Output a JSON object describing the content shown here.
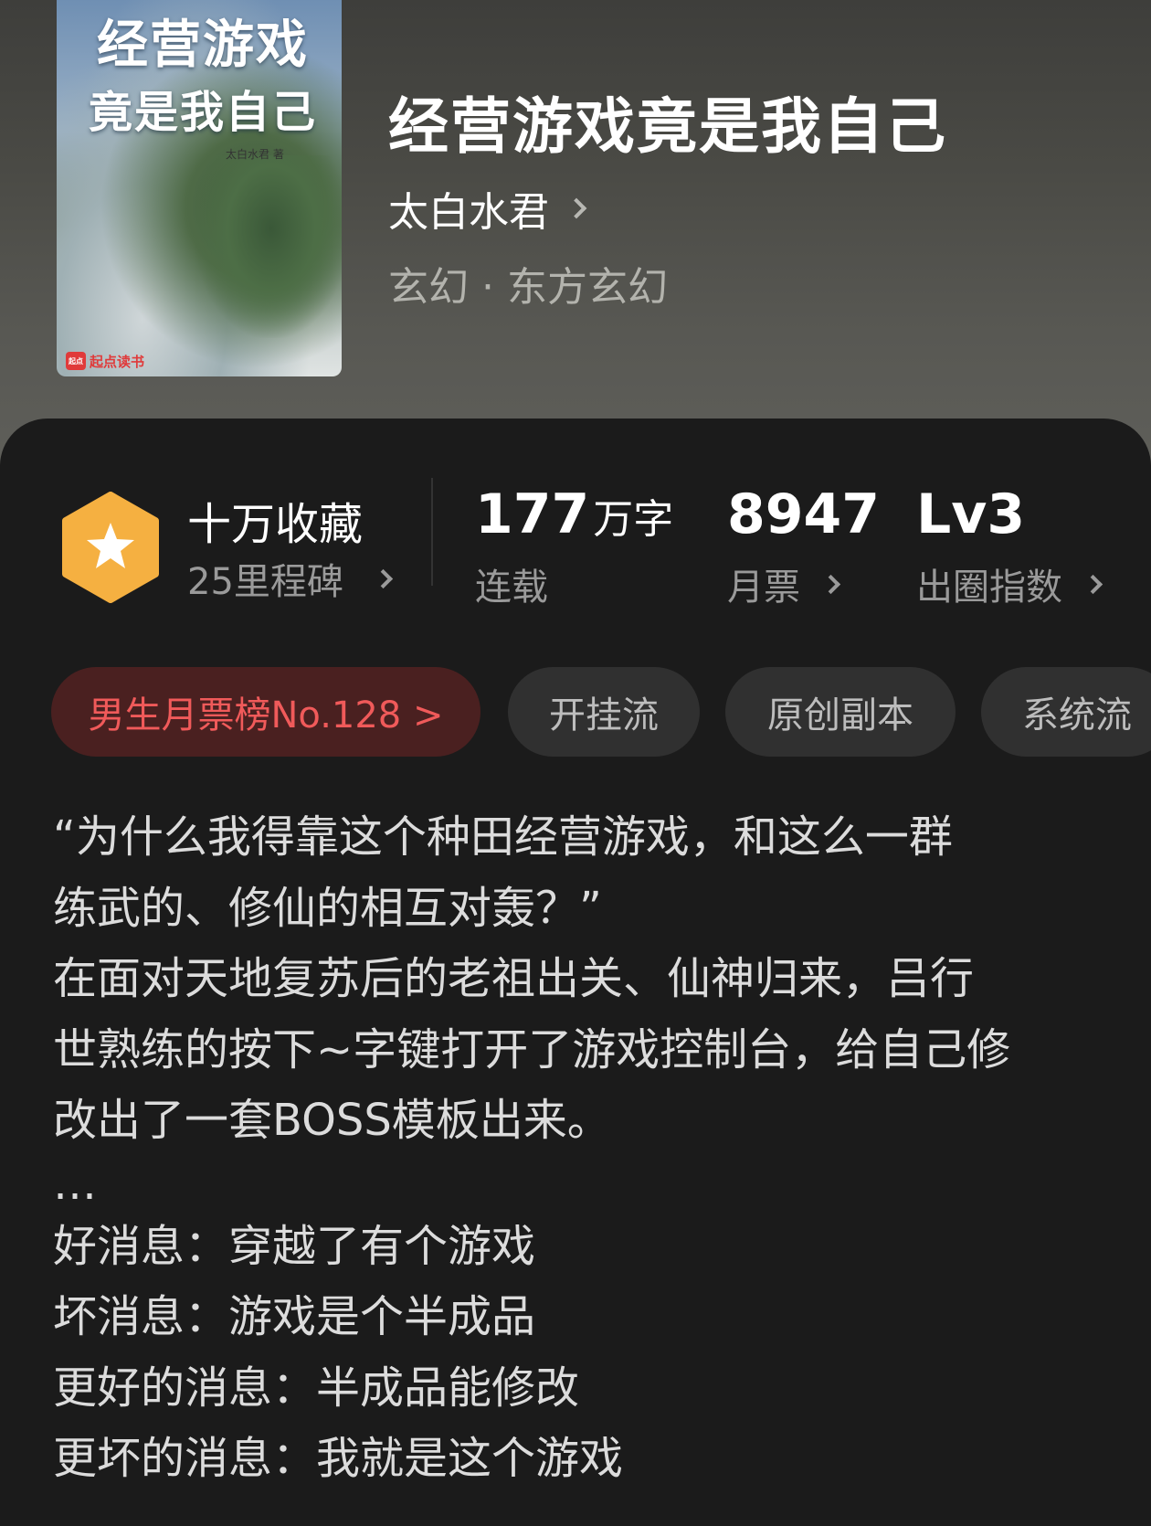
{
  "book": {
    "title": "经营游戏竟是我自己",
    "author": "太白水君",
    "genre": "玄幻 · 东方玄幻",
    "cover": {
      "title_line1": "经营游戏",
      "title_line2": "竟是我自己",
      "author_small": "太白水君 著",
      "brand": "起点读书",
      "brand_logo_text": "起点"
    }
  },
  "stats": {
    "collection": {
      "title": "十万收藏",
      "subtitle": "25里程碑"
    },
    "words": {
      "number": "177",
      "unit": "万字",
      "label": "连载"
    },
    "monthly_tickets": {
      "number": "8947",
      "label": "月票"
    },
    "breakout": {
      "number": "Lv3",
      "label": "出圈指数"
    }
  },
  "tags": [
    {
      "label": "男生月票榜No.128 >"
    },
    {
      "label": "开挂流"
    },
    {
      "label": "原创副本"
    },
    {
      "label": "系统流"
    }
  ],
  "description": [
    "“为什么我得靠这个种田经营游戏，和这么一群",
    "练武的、修仙的相互对轰？”",
    "在面对天地复苏后的老祖出关、仙神归来，吕行",
    "世熟练的按下~字键打开了游戏控制台，给自己修",
    "改出了一套BOSS模板出来。",
    "…",
    "好消息：穿越了有个游戏",
    "坏消息：游戏是个半成品",
    "更好的消息：半成品能修改",
    "更坏的消息：我就是这个游戏"
  ],
  "colors": {
    "badge": "#f5b041",
    "rank_tag_bg": "#4a2020",
    "rank_tag_text": "#f05a5a"
  },
  "icons": [
    "star-badge-icon",
    "chevron-right-icon"
  ]
}
